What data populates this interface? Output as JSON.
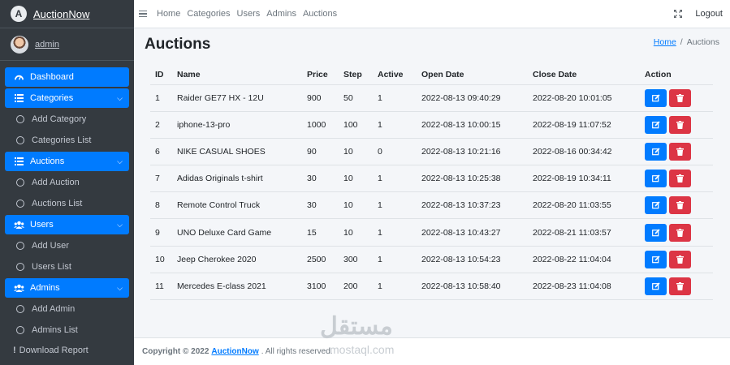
{
  "brand": {
    "name": "AuctionNow",
    "logo_letter": "A"
  },
  "user": {
    "name": "admin"
  },
  "sidebar": {
    "items": [
      {
        "label": "Dashboard",
        "icon": "dashboard-icon",
        "active": true
      },
      {
        "label": "Categories",
        "icon": "list-icon",
        "active": true,
        "children": [
          "Add Category",
          "Categories List"
        ]
      },
      {
        "label": "Auctions",
        "icon": "list-icon",
        "active": true,
        "children": [
          "Add Auction",
          "Auctions List"
        ]
      },
      {
        "label": "Users",
        "icon": "users-icon",
        "active": true,
        "children": [
          "Add User",
          "Users List"
        ]
      },
      {
        "label": "Admins",
        "icon": "users-icon",
        "active": true,
        "children": [
          "Add Admin",
          "Admins List"
        ]
      }
    ],
    "download": "Download Report"
  },
  "topnav": {
    "links": [
      "Home",
      "Categories",
      "Users",
      "Admins",
      "Auctions"
    ],
    "logout": "Logout"
  },
  "page": {
    "title": "Auctions",
    "breadcrumb": {
      "home": "Home",
      "separator": "/",
      "current": "Auctions"
    }
  },
  "table": {
    "columns": [
      "ID",
      "Name",
      "Price",
      "Step",
      "Active",
      "Open Date",
      "Close Date",
      "Action"
    ],
    "rows": [
      [
        "1",
        "Raider GE77 HX - 12U",
        "900",
        "50",
        "1",
        "2022-08-13 09:40:29",
        "2022-08-20 10:01:05"
      ],
      [
        "2",
        "iphone-13-pro",
        "1000",
        "100",
        "1",
        "2022-08-13 10:00:15",
        "2022-08-19 11:07:52"
      ],
      [
        "6",
        "NIKE CASUAL SHOES",
        "90",
        "10",
        "0",
        "2022-08-13 10:21:16",
        "2022-08-16 00:34:42"
      ],
      [
        "7",
        "Adidas Originals t-shirt",
        "30",
        "10",
        "1",
        "2022-08-13 10:25:38",
        "2022-08-19 10:34:11"
      ],
      [
        "8",
        "Remote Control Truck",
        "30",
        "10",
        "1",
        "2022-08-13 10:37:23",
        "2022-08-20 11:03:55"
      ],
      [
        "9",
        "UNO Deluxe Card Game",
        "15",
        "10",
        "1",
        "2022-08-13 10:43:27",
        "2022-08-21 11:03:57"
      ],
      [
        "10",
        "Jeep Cherokee 2020",
        "2500",
        "300",
        "1",
        "2022-08-13 10:54:23",
        "2022-08-22 11:04:04"
      ],
      [
        "11",
        "Mercedes E-class 2021",
        "3100",
        "200",
        "1",
        "2022-08-13 10:58:40",
        "2022-08-23 11:04:08"
      ]
    ]
  },
  "footer": {
    "prefix": "Copyright © 2022",
    "brand": "AuctionNow",
    "suffix": ". All rights reserved."
  },
  "watermark": {
    "arabic": "مستقل",
    "latin": "mostaql.com"
  },
  "colors": {
    "primary": "#007bff",
    "danger": "#dc3545",
    "sidebar": "#343a40"
  }
}
